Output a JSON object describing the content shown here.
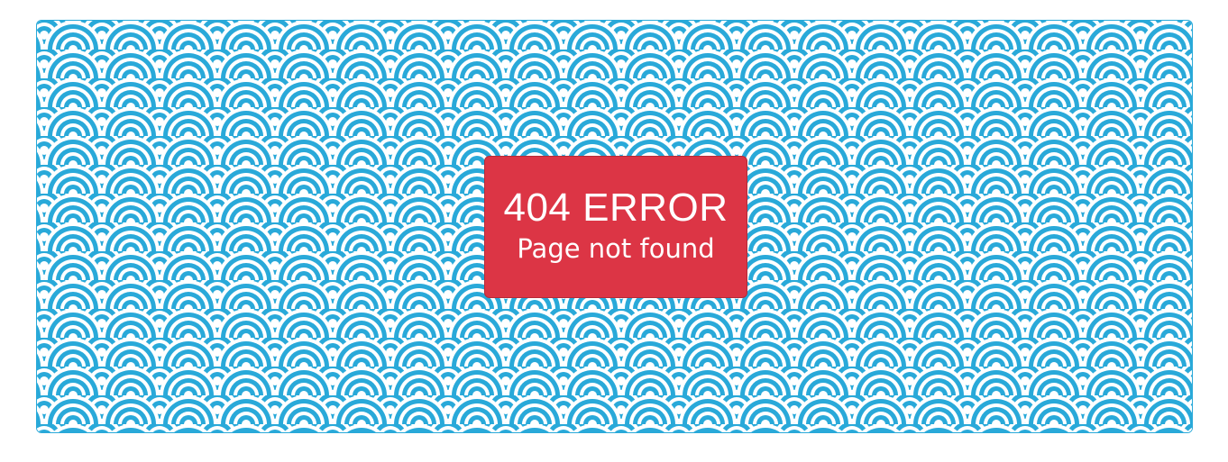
{
  "colors": {
    "wave_blue": "#29a9d9",
    "error_red": "#dc3545",
    "text_white": "#ffffff"
  },
  "background": {
    "pattern": "seigaiha-wave-icon"
  },
  "error": {
    "title": "404 ERROR",
    "message": "Page not found"
  }
}
